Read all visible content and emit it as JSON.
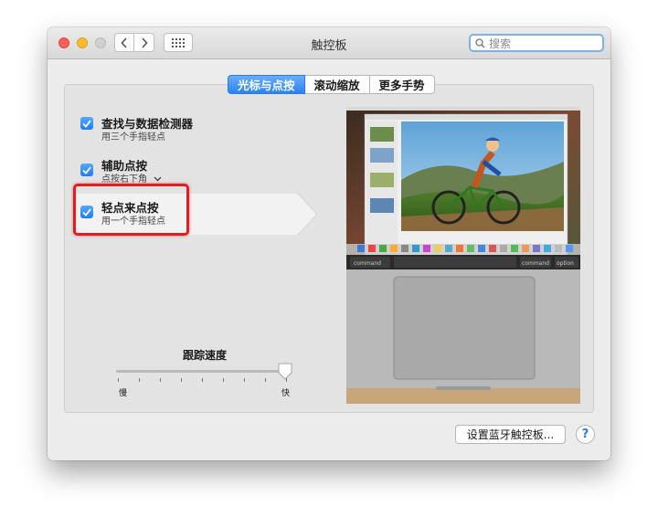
{
  "window": {
    "title": "触控板"
  },
  "search": {
    "placeholder": "搜索"
  },
  "tabs": [
    {
      "label": "光标与点按",
      "active": true
    },
    {
      "label": "滚动缩放",
      "active": false
    },
    {
      "label": "更多手势",
      "active": false
    }
  ],
  "options": [
    {
      "title": "查找与数据检测器",
      "subtitle": "用三个手指轻点",
      "checked": true
    },
    {
      "title": "辅助点按",
      "subtitle": "点按右下角",
      "checked": true
    },
    {
      "title": "轻点来点按",
      "subtitle": "用一个手指轻点",
      "checked": true
    }
  ],
  "tracking": {
    "label": "跟踪速度",
    "slow": "慢",
    "fast": "快",
    "value": 1.0
  },
  "preview": {
    "command_left": "command",
    "command_right": "command",
    "option_right": "option"
  },
  "footer": {
    "bluetooth_button": "设置蓝牙触控板...",
    "help": "?"
  },
  "colors": {
    "accent": "#2a83f4",
    "highlight_border": "#e21d1d"
  }
}
